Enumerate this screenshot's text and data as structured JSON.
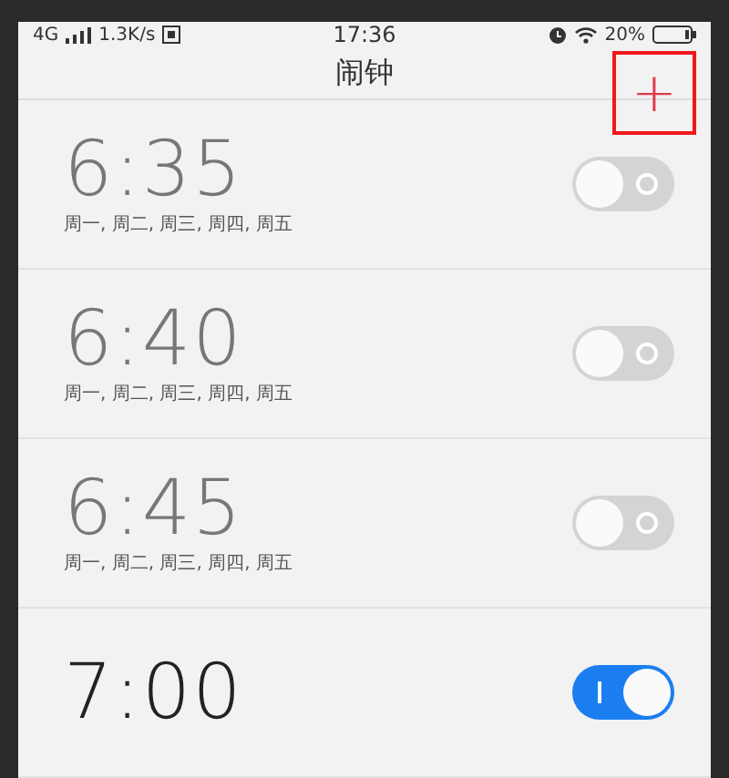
{
  "status_bar": {
    "network": "4G",
    "speed": "1.3K/s",
    "time": "17:36",
    "battery": "20%"
  },
  "title_bar": {
    "title": "闹钟",
    "add_button": "+",
    "highlighted": true
  },
  "alarms": [
    {
      "time": "6:35",
      "days": "周一, 周二, 周三, 周四, 周五",
      "on": false
    },
    {
      "time": "6:40",
      "days": "周一, 周二, 周三, 周四, 周五",
      "on": false
    },
    {
      "time": "6:45",
      "days": "周一, 周二, 周三, 周四, 周五",
      "on": false
    },
    {
      "time": "7:00",
      "on": true
    }
  ]
}
